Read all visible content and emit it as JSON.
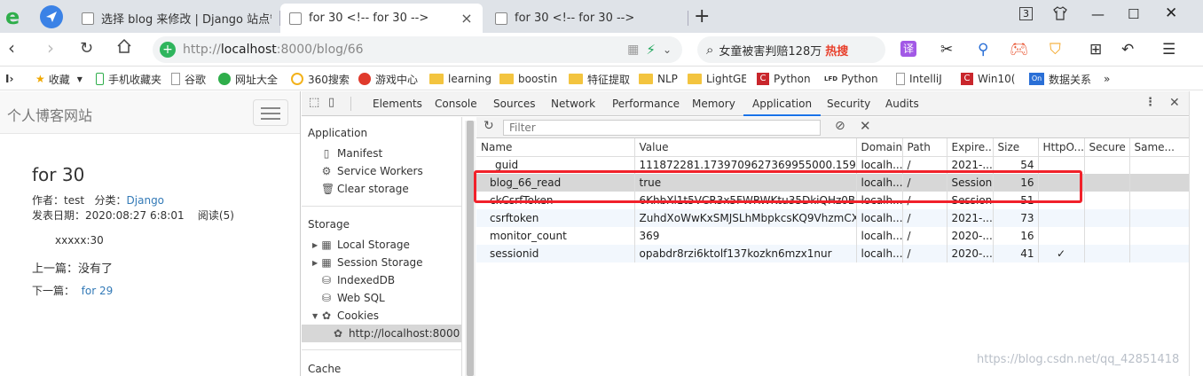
{
  "browser": {
    "tabs": [
      {
        "title": "选择 blog 来修改 | Django 站点管理",
        "active": false
      },
      {
        "title": "for 30 <!-- for 30 -->",
        "active": true
      },
      {
        "title": "for 30 <!-- for 30 -->",
        "active": false
      }
    ],
    "tab_count": "3",
    "url_host_gray": "http://",
    "url_host": "localhost",
    "url_rest": ":8000/blog/66",
    "search_text": "女童被害判赔128万",
    "search_hot": "热搜"
  },
  "bookmarks": [
    {
      "label": "收藏",
      "icon": "star-icon"
    },
    {
      "label": "手机收藏夹",
      "icon": "phone-icon"
    },
    {
      "label": "谷歌",
      "icon": "page-icon"
    },
    {
      "label": "网址大全",
      "icon": "globe-icon"
    },
    {
      "label": "360搜索",
      "icon": "360-icon"
    },
    {
      "label": "游戏中心",
      "icon": "game-icon"
    },
    {
      "label": "learning",
      "icon": "folder-icon"
    },
    {
      "label": "boostin",
      "icon": "folder-icon"
    },
    {
      "label": "特征提取",
      "icon": "folder-icon"
    },
    {
      "label": "NLP",
      "icon": "folder-icon"
    },
    {
      "label": "LightGE",
      "icon": "folder-icon"
    },
    {
      "label": "Python",
      "icon": "c-icon"
    },
    {
      "label": "Python",
      "icon": "lfd-icon"
    },
    {
      "label": "IntelliJ",
      "icon": "page-icon"
    },
    {
      "label": "Win10(",
      "icon": "c-icon"
    },
    {
      "label": "数据关系",
      "icon": "on-icon"
    }
  ],
  "page": {
    "site_name": "个人博客网站",
    "post_title": "for 30",
    "author_label": "作者：",
    "author": "test",
    "category_label": "分类：",
    "category": "Django",
    "date_label": "发表日期：",
    "date": "2020:08:27 6:8:01",
    "reads": "阅读(5)",
    "content": "xxxxx:30",
    "prev_label": "上一篇：",
    "prev_value": "没有了",
    "next_label": "下一篇：",
    "next_value": "for 29"
  },
  "devtools": {
    "tabs": [
      "Elements",
      "Console",
      "Sources",
      "Network",
      "Performance",
      "Memory",
      "Application",
      "Security",
      "Audits"
    ],
    "active_tab": "Application",
    "sidebar": {
      "application_header": "Application",
      "application_items": [
        "Manifest",
        "Service Workers",
        "Clear storage"
      ],
      "storage_header": "Storage",
      "storage_items": [
        "Local Storage",
        "Session Storage",
        "IndexedDB",
        "Web SQL",
        "Cookies"
      ],
      "cookie_origin": "http://localhost:8000",
      "cache_header": "Cache"
    },
    "filter_placeholder": "Filter",
    "columns": [
      "Name",
      "Value",
      "Domain",
      "Path",
      "Expire...",
      "Size",
      "HttpO...",
      "Secure",
      "Same..."
    ],
    "cookies": [
      {
        "name": "_guid",
        "value": "111872281.1739709627369955000.1597302...",
        "domain": "localh...",
        "path": "/",
        "expires": "2021-...",
        "size": "54",
        "httponly": "",
        "secure": "",
        "samesite": ""
      },
      {
        "name": "blog_66_read",
        "value": "true",
        "domain": "localh...",
        "path": "/",
        "expires": "Session",
        "size": "16",
        "httponly": "",
        "secure": "",
        "samesite": ""
      },
      {
        "name": "ckCsrfToken",
        "value": "6KhbXl1t5VCR3x5FWRWKtu35DkiQHz0B6bJK...",
        "domain": "localh...",
        "path": "/",
        "expires": "Session",
        "size": "51",
        "httponly": "",
        "secure": "",
        "samesite": ""
      },
      {
        "name": "csrftoken",
        "value": "ZuhdXoWwKxSMJSLhMbpkcsKQ9VhzmCXP...",
        "domain": "localh...",
        "path": "/",
        "expires": "2021-...",
        "size": "73",
        "httponly": "",
        "secure": "",
        "samesite": ""
      },
      {
        "name": "monitor_count",
        "value": "369",
        "domain": "localh...",
        "path": "/",
        "expires": "2020-...",
        "size": "16",
        "httponly": "",
        "secure": "",
        "samesite": ""
      },
      {
        "name": "sessionid",
        "value": "opabdr8rzi6ktolf137kozkn6mzx1nur",
        "domain": "localh...",
        "path": "/",
        "expires": "2020-...",
        "size": "41",
        "httponly": "✓",
        "secure": "",
        "samesite": ""
      }
    ]
  },
  "watermark": "https://blog.csdn.net/qq_42851418",
  "colors": {
    "accent": "#1a73e8",
    "highlight": "#f1212a",
    "selected_row": "#d7d7d7"
  }
}
